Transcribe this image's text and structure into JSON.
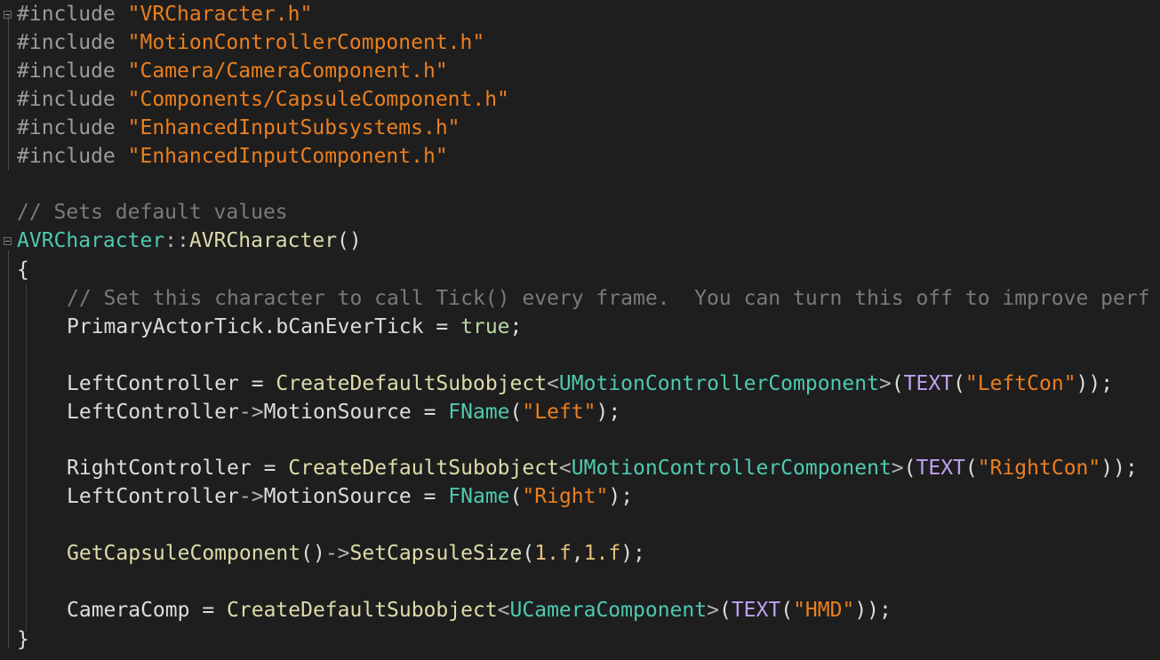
{
  "editor": {
    "includes": [
      {
        "directive": "#include",
        "path": "\"VRCharacter.h\""
      },
      {
        "directive": "#include",
        "path": "\"MotionControllerComponent.h\""
      },
      {
        "directive": "#include",
        "path": "\"Camera/CameraComponent.h\""
      },
      {
        "directive": "#include",
        "path": "\"Components/CapsuleComponent.h\""
      },
      {
        "directive": "#include",
        "path": "\"EnhancedInputSubsystems.h\""
      },
      {
        "directive": "#include",
        "path": "\"EnhancedInputComponent.h\""
      }
    ],
    "comment1": "// Sets default values",
    "ctor": {
      "class": "AVRCharacter",
      "sep": "::",
      "name": "AVRCharacter",
      "parens": "()"
    },
    "brace_open": "{",
    "brace_close": "}",
    "comment2": "// Set this character to call Tick() every frame.  You can turn this off to improve perf",
    "tick": {
      "lhs": "PrimaryActorTick.bCanEverTick",
      "op": " = ",
      "value": "true",
      "end": ";"
    },
    "left": {
      "var": "LeftController",
      "op": " = ",
      "func": "CreateDefaultSubobject",
      "lt": "<",
      "type": "UMotionControllerComponent",
      "gt": ">",
      "open": "(",
      "macro": "TEXT",
      "arg": "\"LeftCon\"",
      "close": "));"
    },
    "left_source": {
      "var": "LeftController",
      "arrow": "->",
      "member": "MotionSource",
      "op": " = ",
      "type": "FName",
      "open": "(",
      "arg": "\"Left\"",
      "close": ");"
    },
    "right": {
      "var": "RightController",
      "op": " = ",
      "func": "CreateDefaultSubobject",
      "lt": "<",
      "type": "UMotionControllerComponent",
      "gt": ">",
      "open": "(",
      "macro": "TEXT",
      "arg": "\"RightCon\"",
      "close": "));"
    },
    "right_source": {
      "var": "LeftController",
      "arrow": "->",
      "member": "MotionSource",
      "op": " = ",
      "type": "FName",
      "open": "(",
      "arg": "\"Right\"",
      "close": ");"
    },
    "capsule": {
      "func1": "GetCapsuleComponent",
      "call": "()",
      "arrow": "->",
      "func2": "SetCapsuleSize",
      "open": "(",
      "n1": "1.f",
      "comma": ",",
      "n2": "1.f",
      "close": ");"
    },
    "camera": {
      "var": "CameraComp",
      "op": " = ",
      "func": "CreateDefaultSubobject",
      "lt": "<",
      "type": "UCameraComponent",
      "gt": ">",
      "open": "(",
      "macro": "TEXT",
      "arg": "\"HMD\"",
      "close": "));"
    },
    "colors": {
      "background": "#1e1e1e",
      "string": "#ea7f1f",
      "type": "#4ec9b0",
      "function": "#dcdcaa",
      "macro": "#bea2f1",
      "comment": "#7a7a7a",
      "directive": "#9b9b9b"
    }
  }
}
